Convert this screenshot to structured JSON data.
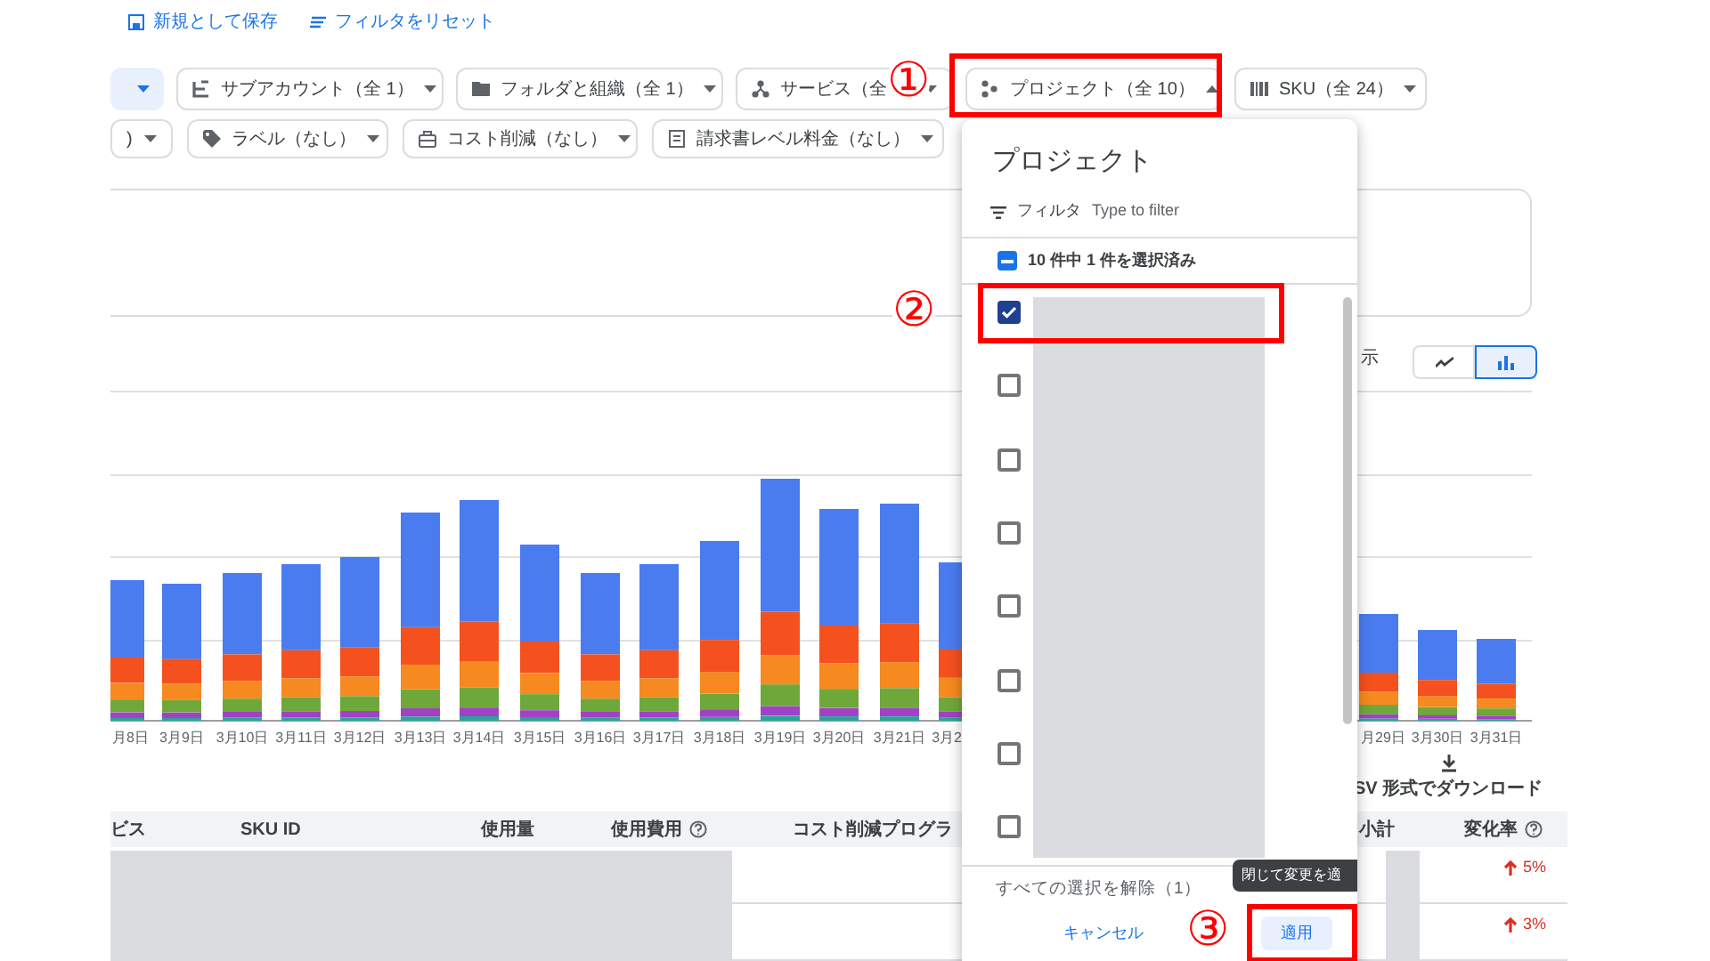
{
  "toolbar": {
    "save_as_new": "新規として保存",
    "reset_filters": "フィルタをリセット"
  },
  "filter_rows": [
    [
      {
        "kind": "plain",
        "highlighted": true,
        "open": false
      },
      {
        "kind": "subaccount",
        "label": "サブアカウント（全 1）",
        "highlighted": false,
        "open": false
      },
      {
        "kind": "folder",
        "label": "フォルダと組織（全 1）",
        "highlighted": false,
        "open": false
      },
      {
        "kind": "service",
        "label": "サービス（全",
        "highlighted": false,
        "open": false
      },
      {
        "kind": "project",
        "label": "プロジェクト（全 10）",
        "highlighted": false,
        "open": true
      },
      {
        "kind": "sku",
        "label": "SKU（全 24）",
        "highlighted": false,
        "open": false
      }
    ],
    [
      {
        "kind": "plain",
        "label": ")",
        "highlighted": false,
        "open": false
      },
      {
        "kind": "tag",
        "label": "ラベル（なし）",
        "highlighted": false,
        "open": false
      },
      {
        "kind": "savings",
        "label": "コスト削減（なし）",
        "highlighted": false,
        "open": false
      },
      {
        "kind": "invoice",
        "label": "請求書レベル料金（なし）",
        "highlighted": false,
        "open": false
      }
    ]
  ],
  "chart": {
    "view_label": "示",
    "view_toggle": [
      {
        "kind": "line",
        "selected": false
      },
      {
        "kind": "bar",
        "selected": true
      }
    ],
    "x_labels": [
      "月8日",
      "3月9日",
      "3月10日",
      "3月11日",
      "3月12日",
      "3月13日",
      "3月14日",
      "3月15日",
      "3月16日",
      "3月17日",
      "3月18日",
      "3月19日",
      "3月20日",
      "3月21日",
      "3月2",
      "月29日",
      "3月30日",
      "3月31日"
    ],
    "download": "SV 形式でダウンロード"
  },
  "table": {
    "columns": [
      {
        "label": "ビス",
        "help": false
      },
      {
        "label": "SKU ID",
        "help": false
      },
      {
        "label": "使用量",
        "help": false
      },
      {
        "label": "使用費用",
        "help": true
      },
      {
        "label": "コスト削減プログラ",
        "help": false
      },
      {
        "label": "小計",
        "help": false
      },
      {
        "label": "変化率",
        "help": true
      }
    ],
    "rows": [
      {
        "change": "5%",
        "rising": true
      },
      {
        "change": "3%",
        "rising": true
      }
    ]
  },
  "project_dropdown": {
    "title": "プロジェクト",
    "filter_label": "フィルタ",
    "placeholder": "Type to filter",
    "summary": "10 件中 1 件を選択済み",
    "indeterminate": true,
    "items": [
      {
        "checked": true
      },
      {
        "checked": false
      },
      {
        "checked": false
      },
      {
        "checked": false
      },
      {
        "checked": false
      },
      {
        "checked": false
      },
      {
        "checked": false
      },
      {
        "checked": false
      }
    ],
    "clear_all": "すべての選択を解除（1）",
    "cancel": "キャンセル",
    "apply": "適用",
    "tooltip": "閉じて変更を適"
  },
  "annotations": [
    {
      "label": "①"
    },
    {
      "label": "②"
    },
    {
      "label": "③"
    }
  ]
}
